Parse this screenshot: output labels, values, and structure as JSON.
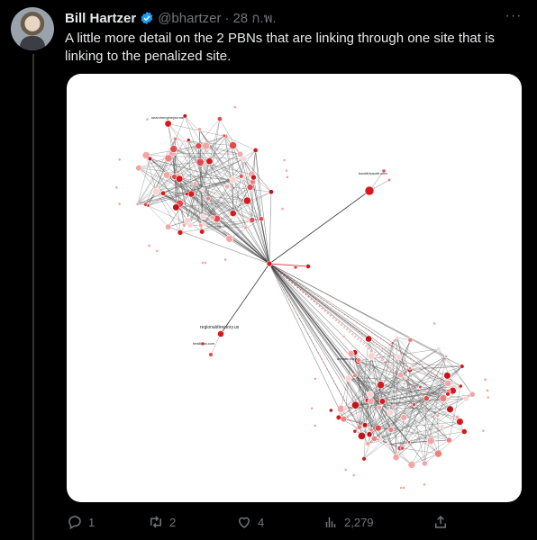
{
  "tweet": {
    "author_name": "Bill Hartzer",
    "handle": "@bhartzer",
    "separator": "·",
    "date": "28 ก.พ.",
    "text": "A little more detail on the 2 PBNs that are linking through one site that is linking to the penalized site.",
    "more_glyph": "···"
  },
  "graph_labels": {
    "top_cluster": "searchenginejournal",
    "right_node": "backlinkaudit.com",
    "left_node": "regionaldirectory.us",
    "left_small": "bestlinks.com",
    "bottom_cluster": "domain.com"
  },
  "actions": {
    "replies": "1",
    "retweets": "2",
    "likes": "4",
    "views": "2,279"
  },
  "colors": {
    "background": "#000000",
    "text": "#e7e9ea",
    "muted": "#71767b",
    "verified": "#1d9bf0",
    "node_red": "#d7191c",
    "edge": "#555555"
  }
}
